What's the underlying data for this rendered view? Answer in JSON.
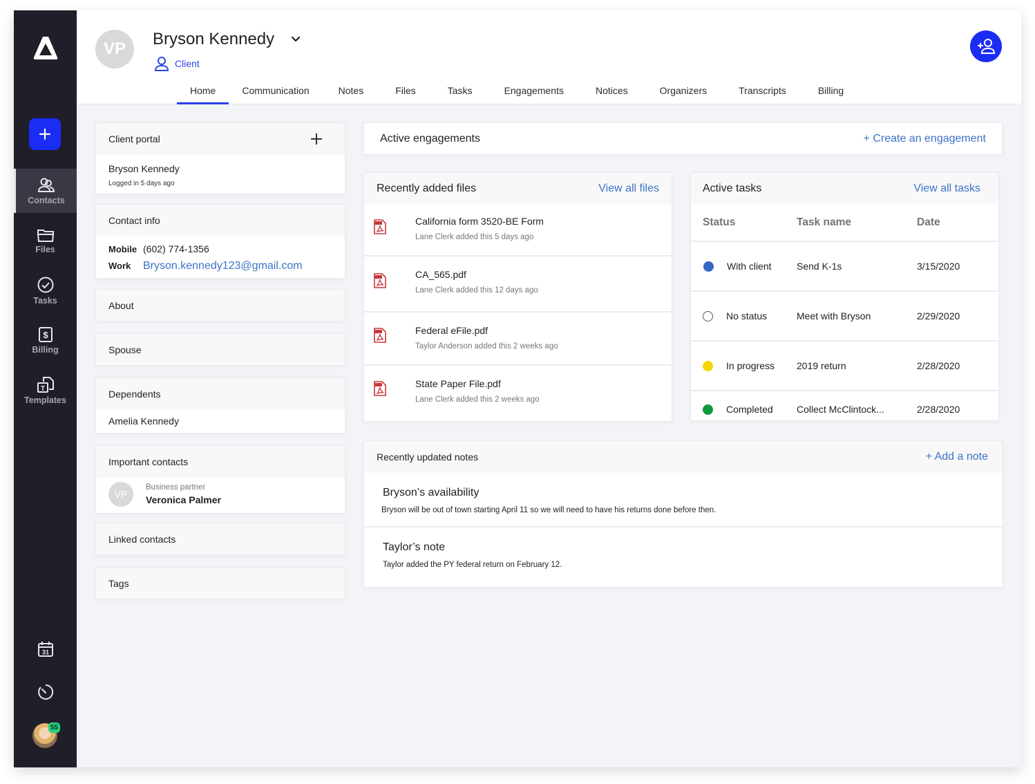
{
  "sidebar": {
    "logo": "delta-logo",
    "add_button_icon": "plus-icon",
    "items": [
      {
        "label": "Contacts",
        "icon": "contacts-icon",
        "active": true
      },
      {
        "label": "Files",
        "icon": "folder-icon",
        "active": false
      },
      {
        "label": "Tasks",
        "icon": "check-circle-icon",
        "active": false
      },
      {
        "label": "Billing",
        "icon": "dollar-icon",
        "active": false
      },
      {
        "label": "Templates",
        "icon": "template-icon",
        "active": false
      }
    ],
    "bottom": {
      "calendar_day": "31",
      "notification_count": "55"
    }
  },
  "header": {
    "avatar_initials": "VP",
    "name": "Bryson Kennedy",
    "role": "Client",
    "tabs": [
      "Home",
      "Communication",
      "Notes",
      "Files",
      "Tasks",
      "Engagements",
      "Notices",
      "Organizers",
      "Transcripts",
      "Billing"
    ],
    "active_tab": "Home"
  },
  "left": {
    "client_portal": {
      "title": "Client portal",
      "name": "Bryson Kennedy",
      "status": "Logged in 5 days ago"
    },
    "contact_info": {
      "title": "Contact info",
      "mobile_label": "Mobile",
      "mobile": "(602) 774-1356",
      "work_label": "Work",
      "work_email": "Bryson.kennedy123@gmail.com"
    },
    "about": {
      "title": "About"
    },
    "spouse": {
      "title": "Spouse"
    },
    "dependents": {
      "title": "Dependents",
      "items": [
        "Amelia Kennedy"
      ]
    },
    "important_contacts": {
      "title": "Important contacts",
      "items": [
        {
          "initials": "VP",
          "role": "Business partner",
          "name": "Veronica Palmer"
        }
      ]
    },
    "linked_contacts": {
      "title": "Linked contacts"
    },
    "tags": {
      "title": "Tags"
    }
  },
  "engagements": {
    "title": "Active engagements",
    "action": "+ Create an engagement"
  },
  "files": {
    "title": "Recently added files",
    "action": "View all files",
    "items": [
      {
        "name": "California form 3520-BE Form",
        "meta": "Lane Clerk added this 5 days ago"
      },
      {
        "name": "CA_565.pdf",
        "meta": "Lane Clerk added this 12 days ago"
      },
      {
        "name": "Federal eFile.pdf",
        "meta": "Taylor Anderson added this 2 weeks ago"
      },
      {
        "name": "State Paper File.pdf",
        "meta": "Lane Clerk added this 2 weeks ago"
      }
    ]
  },
  "tasks": {
    "title": "Active tasks",
    "action": "View all tasks",
    "columns": [
      "Status",
      "Task name",
      "Date"
    ],
    "rows": [
      {
        "status": "With client",
        "color": "#3566c4",
        "name": "Send K-1s",
        "date": "3/15/2020"
      },
      {
        "status": "No status",
        "color": "none",
        "name": "Meet with Bryson",
        "date": "2/29/2020"
      },
      {
        "status": "In progress",
        "color": "#f2d600",
        "name": "2019 return",
        "date": "2/28/2020"
      },
      {
        "status": "Completed",
        "color": "#0b9a3c",
        "name": "Collect McClintock...",
        "date": "2/28/2020"
      }
    ]
  },
  "notes": {
    "title": "Recently updated notes",
    "action": "+ Add a note",
    "items": [
      {
        "title": "Bryson’s availability",
        "body": "Bryson will be out of town starting April 11 so we will need to have his returns done before then."
      },
      {
        "title": "Taylor’s note",
        "body": "Taylor added the PY federal return on February 12."
      }
    ]
  },
  "colors": {
    "accent": "#1b2cf5",
    "link": "#3b73c7",
    "sidebar": "#1f1e29"
  }
}
